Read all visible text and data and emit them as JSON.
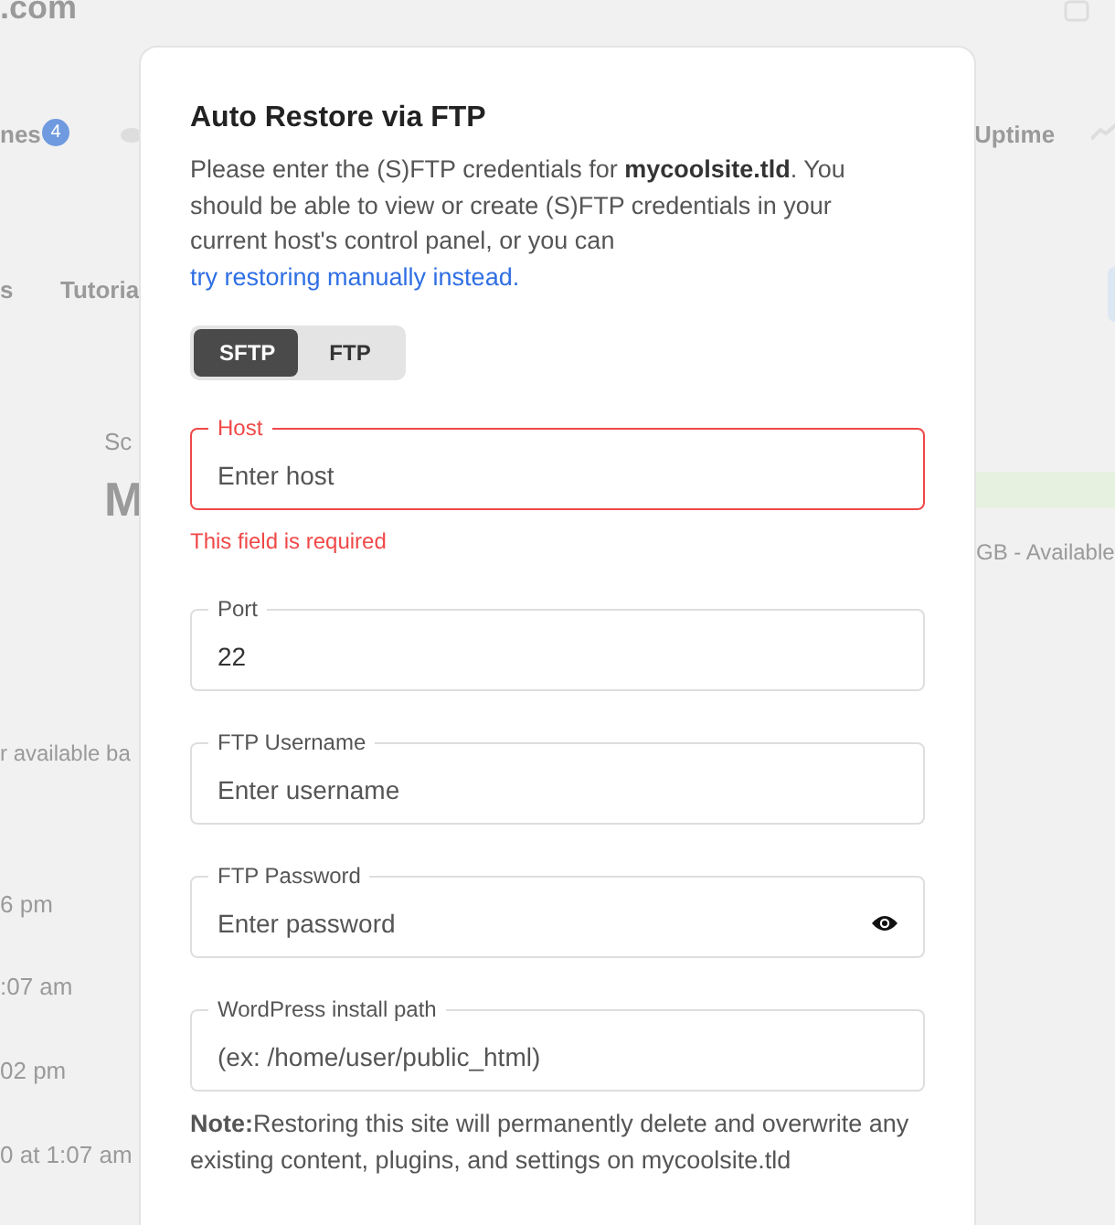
{
  "background": {
    "site": ".com",
    "nav_items": [
      {
        "label": "nes",
        "badge": "4"
      },
      {
        "label": "Uptime"
      }
    ],
    "tabs": [
      "s",
      "Tutoria"
    ],
    "section_label": "Sc",
    "heading": "M",
    "storage": "GB - Available",
    "note": "r available ba",
    "times": [
      "6 pm",
      ":07 am",
      "02 pm",
      "0 at 1:07 am"
    ]
  },
  "dialog": {
    "title": "Auto Restore via FTP",
    "intro": "Please enter the (S)FTP credentials for **mycoolsite.tld**. You should be able to view or create (S)FTP credentials in your current host's control panel, or you can ",
    "link": "try restoring manually instead.",
    "protocols": [
      {
        "label": "SFTP",
        "selected": true
      },
      {
        "label": "FTP",
        "selected": false
      }
    ],
    "fields": [
      {
        "kind": "text",
        "label": "Host",
        "placeholder": "Enter host",
        "invalid": true,
        "error": "This field is required"
      },
      {
        "kind": "text",
        "label": "Port",
        "value": "22",
        "invalid": false
      },
      {
        "kind": "text",
        "label": "FTP Username",
        "placeholder": "Enter username",
        "invalid": false
      },
      {
        "kind": "password",
        "label": "FTP Password",
        "placeholder": "Enter password",
        "invalid": false
      },
      {
        "kind": "text",
        "label": "WordPress install path",
        "placeholder": "(ex: /home/user/public_html)",
        "invalid": false
      }
    ],
    "note": "**Note:**Restoring this site will permanently delete and overwrite any existing content, plugins, and settings on mycoolsite.tld"
  }
}
